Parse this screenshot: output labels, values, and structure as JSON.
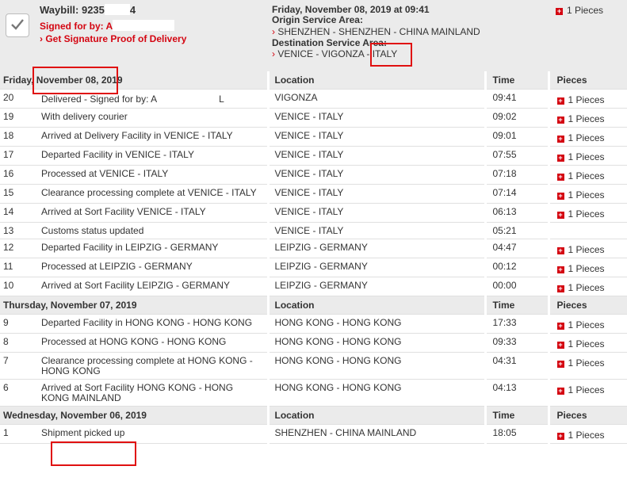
{
  "summary": {
    "waybill_label": "Waybill: 9235",
    "waybill_tail": "4",
    "signed_label": "Signed for by: A",
    "proof_link": "› Get Signature Proof of Delivery",
    "date": "Friday, November 08, 2019 at 09:41",
    "origin_label": "Origin Service Area:",
    "origin_value": "SHENZHEN - SHENZHEN - CHINA MAINLAND",
    "dest_label": "Destination Service Area:",
    "dest_value": "VENICE - VIGONZA - ITALY",
    "pieces": "1 Pieces",
    "arrow": "›",
    "plus": "+"
  },
  "headers": {
    "location": "Location",
    "time": "Time",
    "pieces": "Pieces"
  },
  "days": [
    {
      "label": "Friday, November 08, 2019",
      "events": [
        {
          "n": "20",
          "desc": "Delivered - Signed for by: A",
          "desc_tail": "L",
          "loc": "VIGONZA",
          "time": "09:41",
          "pieces": "1 Pieces"
        },
        {
          "n": "19",
          "desc": "With delivery courier",
          "loc": "VENICE - ITALY",
          "time": "09:02",
          "pieces": "1 Pieces"
        },
        {
          "n": "18",
          "desc": "Arrived at Delivery Facility in VENICE - ITALY",
          "loc": "VENICE - ITALY",
          "time": "09:01",
          "pieces": "1 Pieces"
        },
        {
          "n": "17",
          "desc": "Departed Facility in VENICE - ITALY",
          "loc": "VENICE - ITALY",
          "time": "07:55",
          "pieces": "1 Pieces"
        },
        {
          "n": "16",
          "desc": "Processed at VENICE - ITALY",
          "loc": "VENICE - ITALY",
          "time": "07:18",
          "pieces": "1 Pieces"
        },
        {
          "n": "15",
          "desc": "Clearance processing complete at VENICE - ITALY",
          "loc": "VENICE - ITALY",
          "time": "07:14",
          "pieces": "1 Pieces"
        },
        {
          "n": "14",
          "desc": "Arrived at Sort Facility VENICE - ITALY",
          "loc": "VENICE - ITALY",
          "time": "06:13",
          "pieces": "1 Pieces"
        },
        {
          "n": "13",
          "desc": "Customs status updated",
          "loc": "VENICE - ITALY",
          "time": "05:21",
          "pieces": ""
        },
        {
          "n": "12",
          "desc": "Departed Facility in LEIPZIG - GERMANY",
          "loc": "LEIPZIG - GERMANY",
          "time": "04:47",
          "pieces": "1 Pieces"
        },
        {
          "n": "11",
          "desc": "Processed at LEIPZIG - GERMANY",
          "loc": "LEIPZIG - GERMANY",
          "time": "00:12",
          "pieces": "1 Pieces"
        },
        {
          "n": "10",
          "desc": "Arrived at Sort Facility LEIPZIG - GERMANY",
          "loc": "LEIPZIG - GERMANY",
          "time": "00:00",
          "pieces": "1 Pieces"
        }
      ]
    },
    {
      "label": "Thursday, November 07, 2019",
      "events": [
        {
          "n": "9",
          "desc": "Departed Facility in HONG KONG - HONG KONG",
          "loc": "HONG KONG - HONG KONG",
          "time": "17:33",
          "pieces": "1 Pieces"
        },
        {
          "n": "8",
          "desc": "Processed at HONG KONG - HONG KONG",
          "loc": "HONG KONG - HONG KONG",
          "time": "09:33",
          "pieces": "1 Pieces"
        },
        {
          "n": "7",
          "desc": "Clearance processing complete at HONG KONG - HONG KONG",
          "loc": "HONG KONG - HONG KONG",
          "time": "04:31",
          "pieces": "1 Pieces"
        },
        {
          "n": "6",
          "desc": "Arrived at Sort Facility HONG KONG - HONG KONG MAINLAND",
          "loc": "HONG KONG - HONG KONG",
          "time": "04:13",
          "pieces": "1 Pieces"
        }
      ]
    },
    {
      "label": "Wednesday, November 06, 2019",
      "events": [
        {
          "n": "1",
          "desc": "Shipment picked up",
          "loc": "SHENZHEN - CHINA MAINLAND",
          "time": "18:05",
          "pieces": "1 Pieces"
        }
      ]
    }
  ],
  "colors": {
    "accent": "#d40511",
    "header_bg": "#ebebeb",
    "highlight": "#e01010"
  },
  "icons": {
    "checkmark": "checkmark-icon",
    "plus": "plus-icon"
  }
}
